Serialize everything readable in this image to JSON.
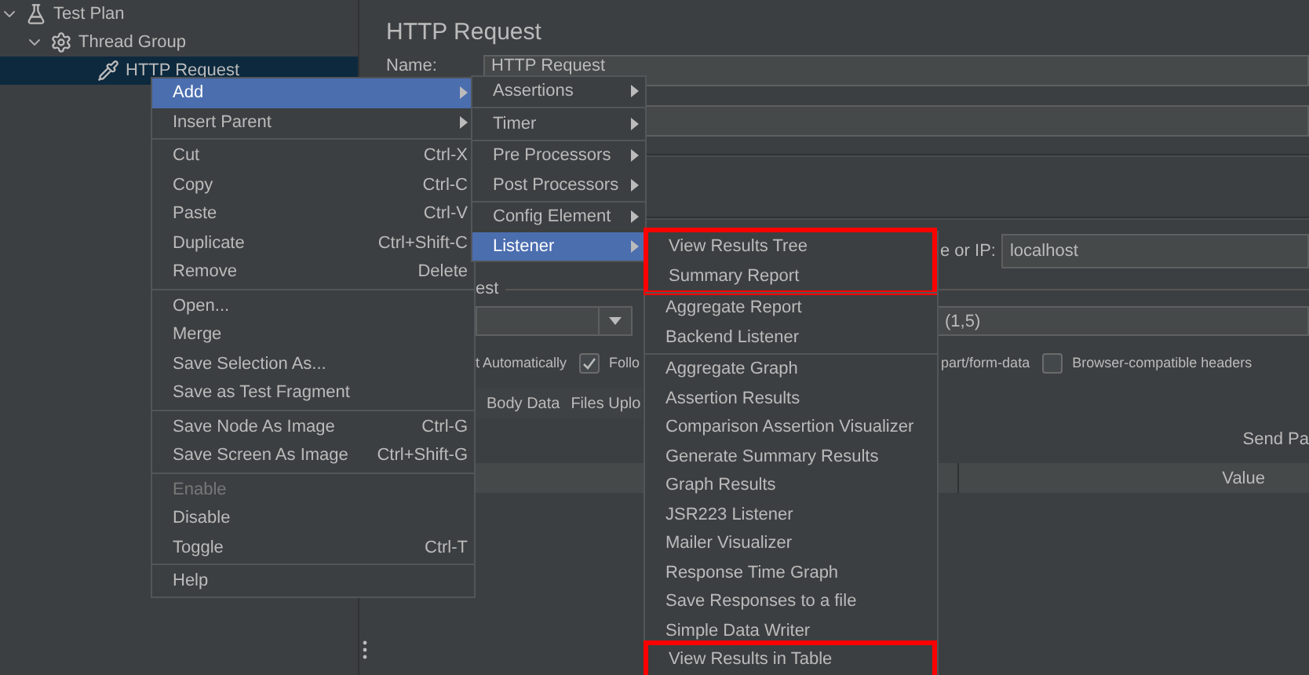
{
  "tree": [
    {
      "label": "Test Plan",
      "kind": "plan",
      "expanded": true,
      "selected": false,
      "children": [
        {
          "label": "Thread Group",
          "kind": "group",
          "expanded": true,
          "selected": false,
          "children": [
            {
              "label": "HTTP Request",
              "kind": "sampler",
              "selected": false,
              "current": true
            }
          ]
        }
      ]
    }
  ],
  "editor": {
    "title": "HTTP Request",
    "name_label": "Name:",
    "name_value": "HTTP Request",
    "server_label": "e or IP:",
    "server_value": "localhost",
    "group_title": "est",
    "field_value": "(1,5)",
    "left_options": [
      {
        "kind": "text",
        "label": "t Automatically"
      },
      {
        "kind": "checkbox",
        "label": "Follo",
        "checked": true
      }
    ],
    "right_options": [
      {
        "kind": "text",
        "label": "part/form-data"
      },
      {
        "kind": "checkbox",
        "label": "Browser-compatible headers",
        "checked": false
      }
    ],
    "tabs": [
      "Body Data",
      "Files Uplo"
    ],
    "send_label": "Send Pa",
    "table": {
      "columns": [
        "Value"
      ]
    }
  },
  "context_menu": {
    "groups": [
      [
        {
          "label": "Add",
          "arrow": true,
          "selected": true,
          "disabled": false
        },
        {
          "label": "Insert Parent",
          "arrow": true,
          "selected": false,
          "disabled": false
        }
      ],
      [
        {
          "label": "Cut",
          "shortcut": "Ctrl-X",
          "arrow": false,
          "selected": false,
          "disabled": false
        },
        {
          "label": "Copy",
          "shortcut": "Ctrl-C",
          "arrow": false,
          "selected": false,
          "disabled": false
        },
        {
          "label": "Paste",
          "shortcut": "Ctrl-V",
          "arrow": false,
          "selected": false,
          "disabled": false
        },
        {
          "label": "Duplicate",
          "shortcut": "Ctrl+Shift-C",
          "arrow": false,
          "selected": false,
          "disabled": false
        },
        {
          "label": "Remove",
          "shortcut": "Delete",
          "arrow": false,
          "selected": false,
          "disabled": false
        }
      ],
      [
        {
          "label": "Open...",
          "arrow": false,
          "selected": false,
          "disabled": false
        },
        {
          "label": "Merge",
          "arrow": false,
          "selected": false,
          "disabled": false
        },
        {
          "label": "Save Selection As...",
          "arrow": false,
          "selected": false,
          "disabled": false
        },
        {
          "label": "Save as Test Fragment",
          "arrow": false,
          "selected": false,
          "disabled": false
        }
      ],
      [
        {
          "label": "Save Node As Image",
          "shortcut": "Ctrl-G",
          "arrow": false,
          "selected": false,
          "disabled": false
        },
        {
          "label": "Save Screen As Image",
          "shortcut": "Ctrl+Shift-G",
          "arrow": false,
          "selected": false,
          "disabled": false
        }
      ],
      [
        {
          "label": "Enable",
          "arrow": false,
          "selected": false,
          "disabled": true
        },
        {
          "label": "Disable",
          "arrow": false,
          "selected": false,
          "disabled": false
        },
        {
          "label": "Toggle",
          "shortcut": "Ctrl-T",
          "arrow": false,
          "selected": false,
          "disabled": false
        }
      ],
      [
        {
          "label": "Help",
          "arrow": false,
          "selected": false,
          "disabled": false
        }
      ]
    ]
  },
  "add_menu": {
    "groups": [
      [
        {
          "label": "Assertions",
          "arrow": true,
          "selected": false
        }
      ],
      [
        {
          "label": "Timer",
          "arrow": true,
          "selected": false
        }
      ],
      [
        {
          "label": "Pre Processors",
          "arrow": true,
          "selected": false
        },
        {
          "label": "Post Processors",
          "arrow": true,
          "selected": false
        }
      ],
      [
        {
          "label": "Config Element",
          "arrow": true,
          "selected": false
        },
        {
          "label": "Listener",
          "arrow": true,
          "selected": true
        }
      ]
    ]
  },
  "listener_menu": {
    "groups": [
      {
        "divider_before": false,
        "highlighted": true,
        "items": [
          {
            "label": "View Results Tree",
            "selected": false
          },
          {
            "label": "Summary Report",
            "selected": false
          }
        ]
      },
      {
        "divider_before": true,
        "highlighted": false,
        "items": [
          {
            "label": "Aggregate Report",
            "selected": false
          },
          {
            "label": "Backend Listener",
            "selected": false
          }
        ]
      },
      {
        "divider_before": true,
        "highlighted": false,
        "items": [
          {
            "label": "Aggregate Graph",
            "selected": false
          },
          {
            "label": "Assertion Results",
            "selected": false
          },
          {
            "label": "Comparison Assertion Visualizer",
            "selected": false
          },
          {
            "label": "Generate Summary Results",
            "selected": false
          },
          {
            "label": "Graph Results",
            "selected": false
          },
          {
            "label": "JSR223 Listener",
            "selected": false
          },
          {
            "label": "Mailer Visualizer",
            "selected": false
          },
          {
            "label": "Response Time Graph",
            "selected": false
          },
          {
            "label": "Save Responses to a file",
            "selected": false
          },
          {
            "label": "Simple Data Writer",
            "selected": false
          }
        ]
      },
      {
        "divider_before": false,
        "highlighted": true,
        "items": [
          {
            "label": "View Results in Table",
            "selected": false
          }
        ]
      }
    ]
  }
}
